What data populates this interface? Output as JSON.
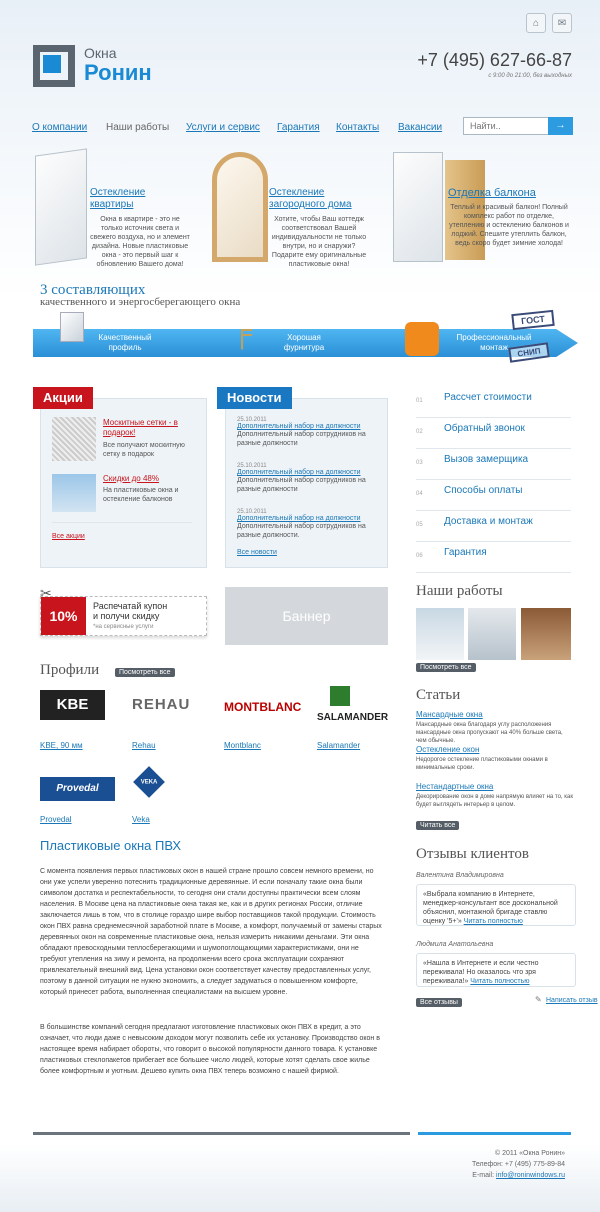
{
  "header": {
    "logo_line1": "Окна",
    "logo_line2": "Ронин",
    "phone": "+7 (495) 627-66-87",
    "hours": "с 9:00 до 21:00, без выходных",
    "home_icon": "home-icon",
    "mail_icon": "mail-icon"
  },
  "nav": {
    "items": [
      "О компании",
      "Наши работы",
      "Услуги и сервис",
      "Гарантия",
      "Контакты",
      "Вакансии"
    ],
    "search_placeholder": "Найти..",
    "search_btn": "→"
  },
  "promos": [
    {
      "title": "Остекление квартиры",
      "text": "Окна в квартире - это не только источник света и свежего воздуха, но и элемент дизайна. Новые пластиковые окна - это первый шаг к обновлению Вашего дома!"
    },
    {
      "title": "Остекление загородного дома",
      "text": "Хотите, чтобы Ваш коттедж соответствовал Вашей индивидуальности не только внутри, но и снаружи? Подарите ему оригинальные пластиковые окна!"
    },
    {
      "title": "Отделка балкона",
      "text": "Теплый и красивый балкон! Полный комплекс работ по отделке, утеплению и остеклению балконов и лоджий. Спешите утеплить балкон, ведь скоро будет зимние холода!"
    }
  ],
  "components": {
    "title": "3 составляющих",
    "subtitle": "качественного и энергосберегающего окна",
    "items": [
      "Качественный профиль",
      "Хорошая фурнитура",
      "Профессиональный монтаж"
    ],
    "stamp1": "ГОСТ",
    "stamp2": "СНИП"
  },
  "actions": {
    "tag": "Акции",
    "items": [
      {
        "title": "Москитные сетки - в подарок!",
        "text": "Все получают москитную сетку в подарок"
      },
      {
        "title": "Скидки до 48%",
        "text": "На пластиковые окна и остекление балконов"
      }
    ],
    "all": "Все акции"
  },
  "news": {
    "tag": "Новости",
    "items": [
      {
        "date": "25.10.2011",
        "title": "Дополнительный набор на должности",
        "text": "Дополнительный набор сотрудников на разные должности"
      },
      {
        "date": "25.10.2011",
        "title": "Дополнительный набор на должности",
        "text": "Дополнительный набор сотрудников на разные должности"
      },
      {
        "date": "25.10.2011",
        "title": "Дополнительный набор на должности",
        "text": "Дополнительный набор сотрудников на разные должности."
      }
    ],
    "all": "Все новости"
  },
  "services": [
    {
      "num": "01",
      "label": "Рассчет стоимости"
    },
    {
      "num": "02",
      "label": "Обратный звонок"
    },
    {
      "num": "03",
      "label": "Вызов замерщика"
    },
    {
      "num": "04",
      "label": "Способы оплаты"
    },
    {
      "num": "05",
      "label": "Доставка и монтаж"
    },
    {
      "num": "06",
      "label": "Гарантия"
    }
  ],
  "coupon": {
    "percent": "10%",
    "line1": "Распечатай купон",
    "line2": "и получи скидку",
    "note": "*на сервисные услуги"
  },
  "banner": "Баннер",
  "profiles": {
    "title": "Профили",
    "see_all": "Посмотреть все",
    "brands": [
      {
        "logo": "KBE",
        "name": "KBE, 90 мм"
      },
      {
        "logo": "REHAU",
        "name": "Rehau"
      },
      {
        "logo": "MONTBLANC",
        "name": "Montblanc"
      },
      {
        "logo": "SALAMANDER",
        "name": "Salamander"
      },
      {
        "logo": "Provedal",
        "name": "Provedal"
      },
      {
        "logo": "VEKA",
        "name": "Veka"
      }
    ]
  },
  "works": {
    "title": "Наши работы",
    "see_all": "Посмотреть все"
  },
  "article": {
    "title": "Пластиковые окна ПВХ",
    "p1": "С момента появления первых пластиковых окон в нашей стране прошло совсем немного времени, но они уже успели уверенно потеснить традиционные деревянные. И если поначалу такие окна были символом достатка и респектабельности, то сегодня они стали доступны практически всем слоям населения. В Москве цена на пластиковые окна такая же, как и в других регионах России, отличие заключается лишь в том, что в столице гораздо шире выбор поставщиков такой продукции. Стоимость окон ПВХ равна среднемесячной заработной плате в Москве, а комфорт, получаемый от замены старых деревянных окон на современные пластиковые окна, нельзя измерить никакими деньгами. Эти окна обладают превосходными теплосберегающими и шумопоглощающими характеристиками, они не требуют утепления на зиму и ремонта, на продолжении всего срока эксплуатации сохраняют привлекательный внешний вид. Цена установки окон соответствует качеству предоставленных услуг, поэтому в данной ситуации не нужно экономить, а следует задуматься о повышенном комфорте, который принесет работа, выполненная специалистами на высшем уровне.",
    "p2": "В большинстве компаний сегодня предлагают изготовление пластиковых окон ПВХ в кредит, а это означает, что люди даже с невысоким доходом могут позволить себе их установку. Производство окон в настоящее время набирает обороты, что говорит о высокой популярности данного товара. К установке пластиковых стеклопакетов прибегает все большее число людей, которые хотят сделать свое жилье более комфортным и уютным. Дешево купить окна ПВХ теперь возможно с нашей фирмой."
  },
  "articles": {
    "title": "Статьи",
    "items": [
      {
        "title": "Мансардные окна",
        "text": "Мансардные окна благодаря углу расположения мансардные окна пропускают на 40% больше света, чем обычные."
      },
      {
        "title": "Остекление окон",
        "text": "Недорогое остекление пластиковыми окнами в минимальные сроки."
      },
      {
        "title": "Нестандартные окна",
        "text": "Декорирование окон в доме напрямую влияет на то, как будет выглядеть интерьер в целом."
      }
    ],
    "all": "Читать все"
  },
  "reviews": {
    "title": "Отзывы клиентов",
    "items": [
      {
        "author": "Валентина Владимировна",
        "text": "«Выбрала компанию в Интернете, менеджер-консультант все доскональной объяснил, монтажной бригаде ставлю оценку '5+'»",
        "link": "Читать полностью"
      },
      {
        "author": "Людмила Анатольевна",
        "text": "«Нашла в Интернете и если честно переживала! Но оказалось что зря переживала!»",
        "link": "Читать полностью"
      }
    ],
    "all": "Все отзывы",
    "write": "Написать отзыв"
  },
  "footer": {
    "copy": "© 2011 «Окна Ронин»",
    "phone": "Телефон: +7 (495) 775-89-84",
    "email_label": "E-mail:",
    "email": "info@roninwindows.ru"
  }
}
